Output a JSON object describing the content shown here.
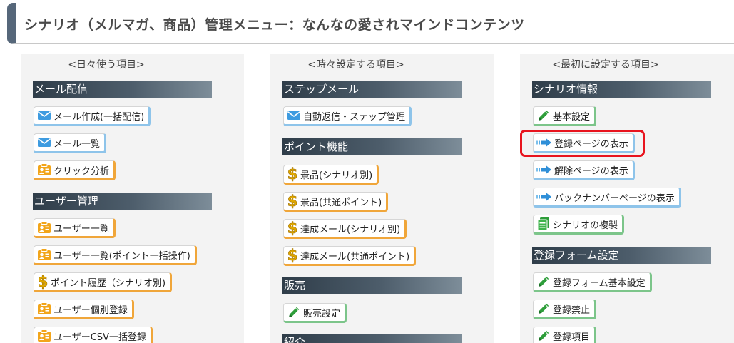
{
  "header": {
    "title": "シナリオ（メルマガ、商品）管理メニュー：なんなの愛されマインドコンテンツ"
  },
  "columns": [
    {
      "heading": "<日々使う項目>",
      "sections": [
        {
          "title": "メール配信",
          "items": [
            {
              "label": "メール作成(一括配信)",
              "icon": "envelope-icon",
              "accent": "blue"
            },
            {
              "label": "メール一覧",
              "icon": "envelope-icon",
              "accent": "blue"
            },
            {
              "label": "クリック分析",
              "icon": "contact-card-icon",
              "accent": "orange"
            }
          ]
        },
        {
          "title": "ユーザー管理",
          "items": [
            {
              "label": "ユーザー一覧",
              "icon": "contact-card-icon",
              "accent": "orange"
            },
            {
              "label": "ユーザー一覧(ポイント一括操作)",
              "icon": "contact-card-icon",
              "accent": "orange"
            },
            {
              "label": "ポイント履歴（シナリオ別)",
              "icon": "dollar-icon",
              "accent": "orange"
            },
            {
              "label": "ユーザー個別登録",
              "icon": "contact-card-icon",
              "accent": "orange"
            },
            {
              "label": "ユーザーCSV一括登録",
              "icon": "contact-card-icon",
              "accent": "orange"
            }
          ]
        }
      ]
    },
    {
      "heading": "<時々設定する項目>",
      "sections": [
        {
          "title": "ステップメール",
          "items": [
            {
              "label": "自動返信・ステップ管理",
              "icon": "envelope-icon",
              "accent": "blue"
            }
          ]
        },
        {
          "title": "ポイント機能",
          "items": [
            {
              "label": "景品(シナリオ別)",
              "icon": "dollar-icon",
              "accent": "orange"
            },
            {
              "label": "景品(共通ポイント)",
              "icon": "dollar-icon",
              "accent": "orange"
            },
            {
              "label": "達成メール(シナリオ別)",
              "icon": "dollar-icon",
              "accent": "orange"
            },
            {
              "label": "達成メール(共通ポイント)",
              "icon": "dollar-icon",
              "accent": "orange"
            }
          ]
        },
        {
          "title": "販売",
          "items": [
            {
              "label": "販売設定",
              "icon": "pencil-icon",
              "accent": "green"
            }
          ]
        },
        {
          "title": "紹介",
          "items": []
        }
      ]
    },
    {
      "heading": "<最初に設定する項目>",
      "sections": [
        {
          "title": "シナリオ情報",
          "items": [
            {
              "label": "基本設定",
              "icon": "pencil-icon",
              "accent": "green"
            },
            {
              "label": "登録ページの表示",
              "icon": "arrow-right-icon",
              "accent": "blue"
            },
            {
              "label": "解除ページの表示",
              "icon": "arrow-right-icon",
              "accent": "blue"
            },
            {
              "label": "バックナンバーページの表示",
              "icon": "arrow-right-icon",
              "accent": "blue"
            },
            {
              "label": "シナリオの複製",
              "icon": "copy-icon",
              "accent": "green"
            }
          ]
        },
        {
          "title": "登録フォーム設定",
          "items": [
            {
              "label": "登録フォーム基本設定",
              "icon": "pencil-icon",
              "accent": "green"
            },
            {
              "label": "登録禁止",
              "icon": "pencil-icon",
              "accent": "green"
            },
            {
              "label": "登録項目",
              "icon": "pencil-icon",
              "accent": "green"
            }
          ]
        }
      ]
    }
  ],
  "colors": {
    "header_accent": "#56677a",
    "section_bar_dark": "#2f3d49",
    "section_bar_light": "#7d8d99",
    "accent_blue": "#8ec4ea",
    "accent_orange": "#f0a63a",
    "accent_green": "#7cc58a",
    "highlight_red": "#e8141e"
  }
}
